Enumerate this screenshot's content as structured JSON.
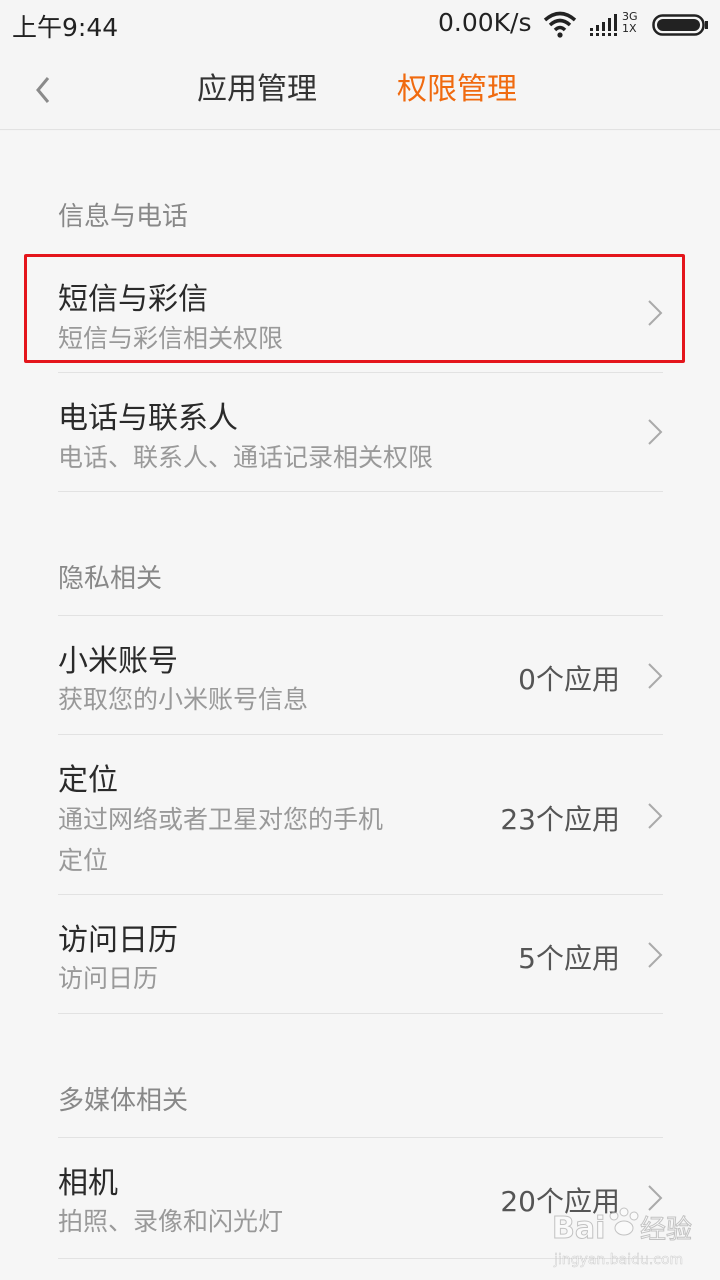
{
  "status_bar": {
    "time": "上午9:44",
    "speed": "0.00K/s",
    "network_top": "3G",
    "network_bottom": "1X"
  },
  "header": {
    "back_icon": "chevron-left-icon",
    "tabs": [
      {
        "label": "应用管理",
        "active": false
      },
      {
        "label": "权限管理",
        "active": true
      }
    ],
    "active_color": "#f06a0f"
  },
  "sections": [
    {
      "title": "信息与电话",
      "items": [
        {
          "title": "短信与彩信",
          "subtitle": "短信与彩信相关权限",
          "count": ""
        },
        {
          "title": "电话与联系人",
          "subtitle": "电话、联系人、通话记录相关权限",
          "count": ""
        }
      ]
    },
    {
      "title": "隐私相关",
      "items": [
        {
          "title": "小米账号",
          "subtitle": "获取您的小米账号信息",
          "count": "0个应用"
        },
        {
          "title": "定位",
          "subtitle_line1": "通过网络或者卫星对您的手机",
          "subtitle_line2": "定位",
          "count": "23个应用"
        },
        {
          "title": "访问日历",
          "subtitle": "访问日历",
          "count": "5个应用"
        }
      ]
    },
    {
      "title": "多媒体相关",
      "items": [
        {
          "title": "相机",
          "subtitle": "拍照、录像和闪光灯",
          "count": "20个应用"
        }
      ]
    }
  ],
  "highlight_color": "#e4151b",
  "watermark": {
    "brand": "Bai",
    "brand_suffix": "经验",
    "url": "jingyan.baidu.com"
  }
}
